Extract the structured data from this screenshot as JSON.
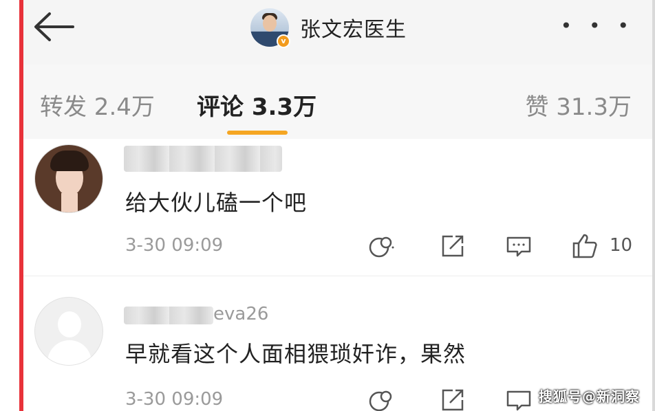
{
  "header": {
    "title": "张文宏医生",
    "verified_badge": "v",
    "back_icon": "back-arrow-icon",
    "more_label": "• • •"
  },
  "tabs": [
    {
      "label": "转发 2.4万"
    },
    {
      "label": "评论 3.3万",
      "active": true
    },
    {
      "label": "赞 31.3万"
    }
  ],
  "accent_color": "#f5a623",
  "side_bar_color": "#e8323a",
  "comments": [
    {
      "text": "给大伙儿磕一个吧",
      "time": "3-30 09:09",
      "likes": "10"
    },
    {
      "username_visible_suffix": "eva26",
      "text": "早就看这个人面相猥琐奸诈，果然",
      "time": "3-30 09:09"
    }
  ],
  "watermark": "搜狐号@新洞察"
}
